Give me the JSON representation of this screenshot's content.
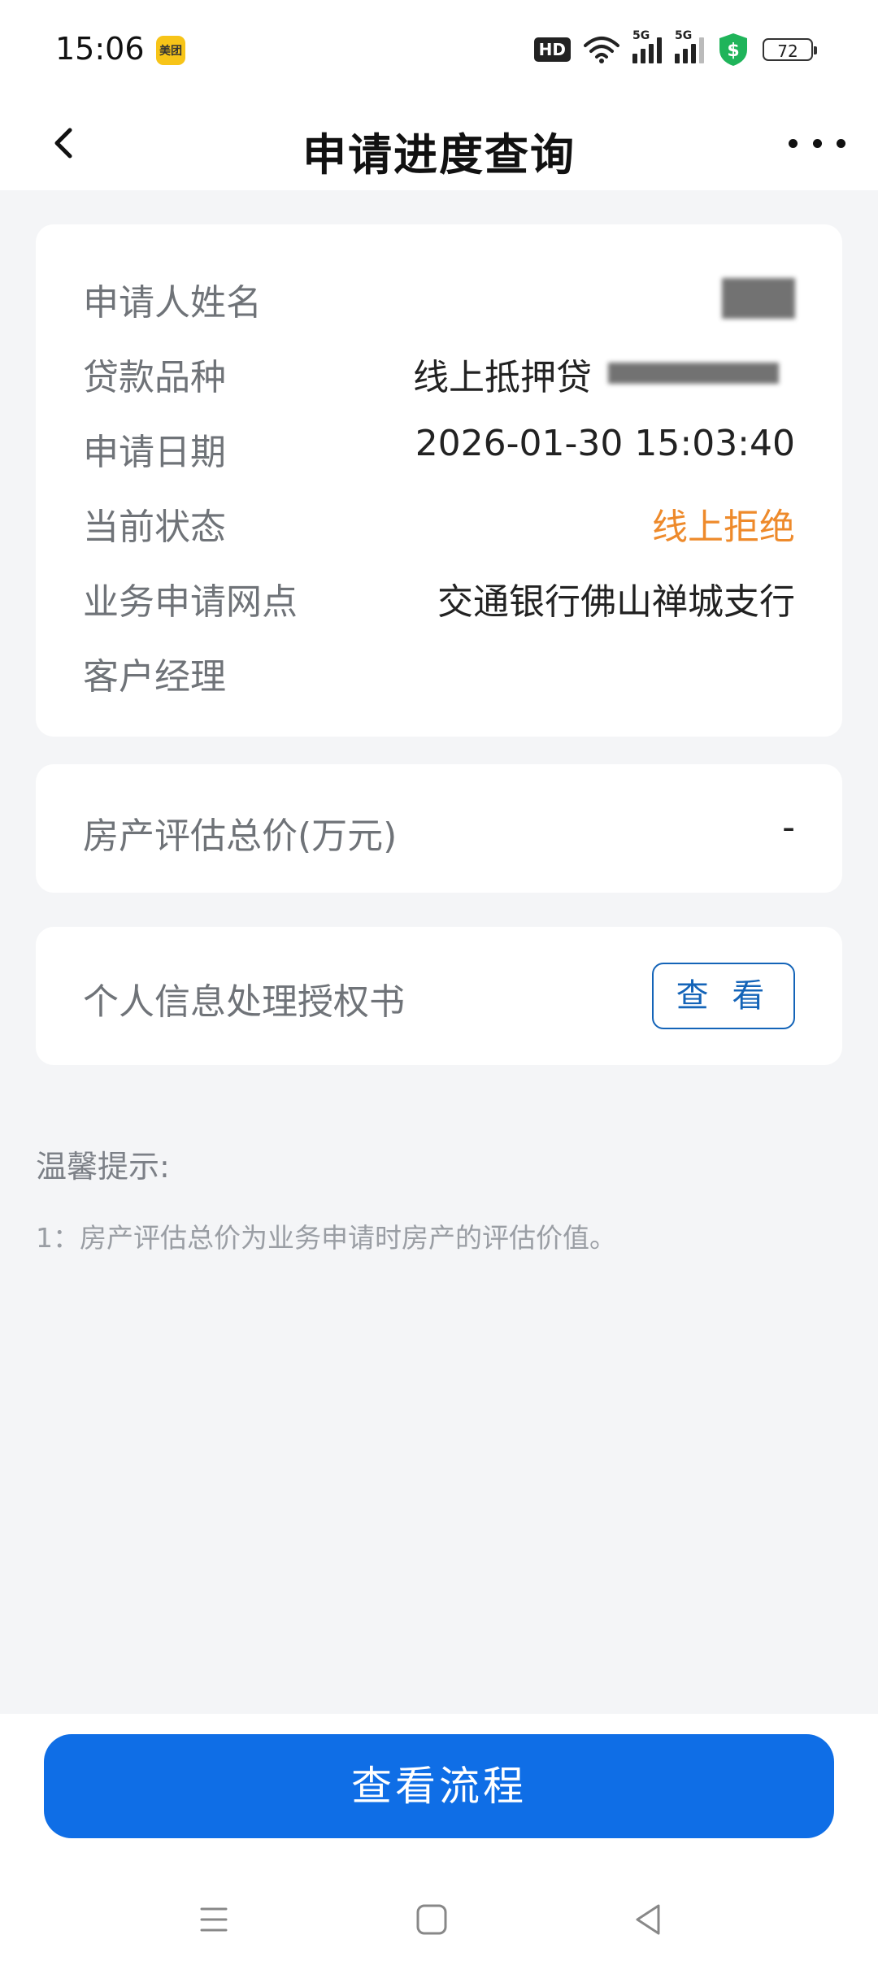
{
  "status_bar": {
    "time": "15:06",
    "app_badge": "美团",
    "hd_label": "HD",
    "signal1_label": "5G",
    "signal2_label": "5G",
    "battery": "72"
  },
  "header": {
    "title": "申请进度查询"
  },
  "info_card": {
    "rows": [
      {
        "label": "申请人姓名",
        "value": ""
      },
      {
        "label": "贷款品种",
        "value": "线上抵押贷"
      },
      {
        "label": "申请日期",
        "value": "2026-01-30 15:03:40"
      },
      {
        "label": "当前状态",
        "value": "线上拒绝"
      },
      {
        "label": "业务申请网点",
        "value": "交通银行佛山禅城支行"
      },
      {
        "label": "客户经理",
        "value": ""
      }
    ]
  },
  "valuation_card": {
    "label": "房产评估总价(万元)",
    "value": "-"
  },
  "auth_card": {
    "label": "个人信息处理授权书",
    "button_label": "查 看"
  },
  "tips": {
    "title": "温馨提示:",
    "lines": [
      "1：房产评估总价为业务申请时房产的评估价值。"
    ]
  },
  "footer": {
    "button_label": "查看流程"
  },
  "colors": {
    "primary": "#0f6ee6",
    "status_rejected": "#ee8a2b",
    "link_border": "#1464b8"
  }
}
